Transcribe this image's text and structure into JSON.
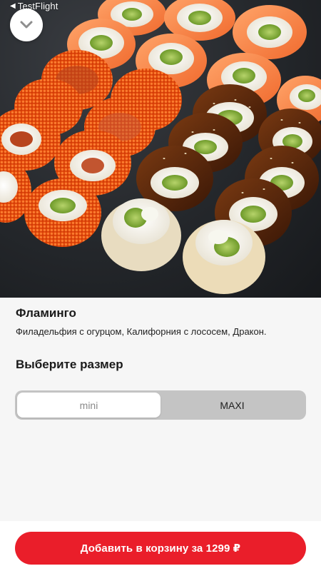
{
  "status_bar": {
    "back_glyph": "◀",
    "back_label": "TestFlight"
  },
  "header": {
    "close_icon": "chevron-down-icon"
  },
  "product": {
    "title": "Фламинго",
    "description": "Филадельфия с огурцом, Калифорния с лососем, Дракон."
  },
  "size_picker": {
    "heading": "Выберите размер",
    "options": [
      {
        "label": "mini",
        "selected": true
      },
      {
        "label": "MAXI",
        "selected": false
      }
    ]
  },
  "cart": {
    "button_label": "Добавить в корзину за 1299 ₽"
  },
  "colors": {
    "accent": "#ea1e2a",
    "background": "#f6f6f6",
    "segment_track": "#c4c4c4"
  }
}
